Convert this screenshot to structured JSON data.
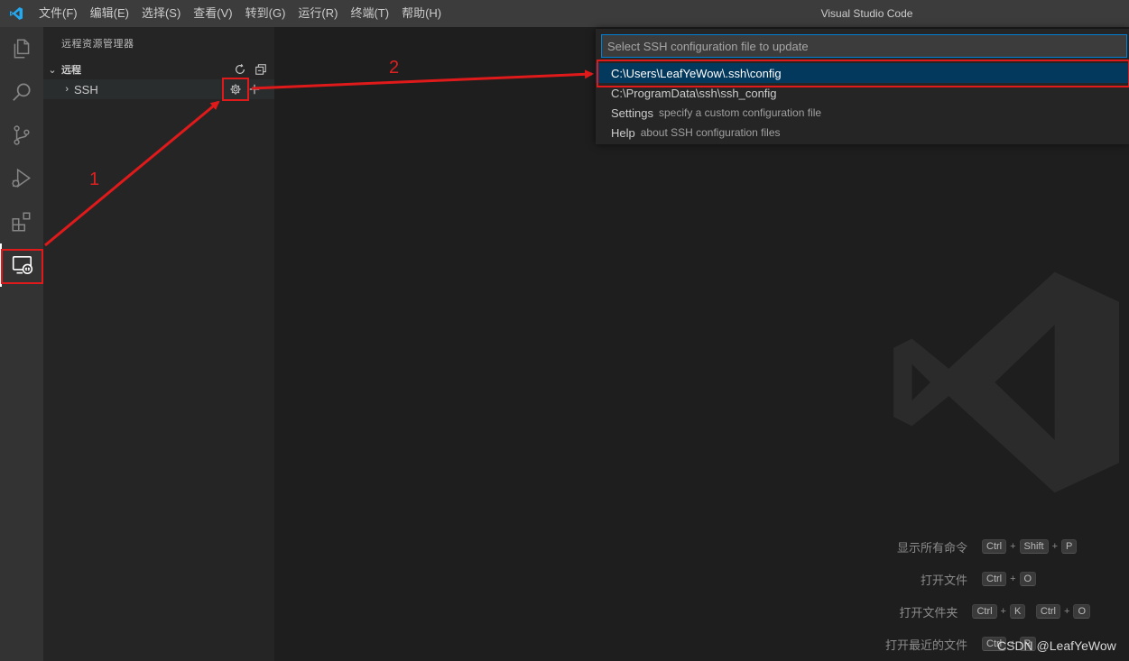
{
  "window": {
    "title": "Visual Studio Code"
  },
  "menu": {
    "items": [
      "文件(F)",
      "编辑(E)",
      "选择(S)",
      "查看(V)",
      "转到(G)",
      "运行(R)",
      "终端(T)",
      "帮助(H)"
    ]
  },
  "activity_bar": {
    "icons": [
      "explorer-icon",
      "search-icon",
      "source-control-icon",
      "run-debug-icon",
      "extensions-icon",
      "remote-explorer-icon"
    ],
    "active": "remote-explorer-icon"
  },
  "sidebar": {
    "title": "远程资源管理器",
    "section": {
      "title": "远程",
      "actions": [
        "refresh-icon",
        "collapse-all-icon"
      ]
    },
    "rows": [
      {
        "label": "SSH",
        "actions": [
          "gear-icon",
          "add-icon"
        ]
      }
    ]
  },
  "quick_pick": {
    "placeholder": "Select SSH configuration file to update",
    "items": [
      {
        "label": "C:\\Users\\LeafYeWow\\.ssh\\config",
        "description": "",
        "selected": true
      },
      {
        "label": "C:\\ProgramData\\ssh\\ssh_config",
        "description": "",
        "selected": false
      },
      {
        "label": "Settings",
        "description": "specify a custom configuration file",
        "selected": false
      },
      {
        "label": "Help",
        "description": "about SSH configuration files",
        "selected": false
      }
    ]
  },
  "shortcuts": [
    {
      "label": "显示所有命令",
      "keys": [
        "Ctrl",
        "Shift",
        "P"
      ]
    },
    {
      "label": "打开文件",
      "keys": [
        "Ctrl",
        "O"
      ]
    },
    {
      "label": "打开文件夹",
      "keys": [
        "Ctrl",
        "K",
        "Ctrl",
        "O"
      ]
    },
    {
      "label": "打开最近的文件",
      "keys": [
        "Ctrl",
        "R"
      ]
    }
  ],
  "annotations": {
    "step1": "1",
    "step2": "2"
  },
  "credit": "CSDN @LeafYeWow",
  "colors": {
    "accent": "#007fd4",
    "selection": "#04395e",
    "annotation": "#e01a1a",
    "vscode_blue": "#23a9f2"
  }
}
